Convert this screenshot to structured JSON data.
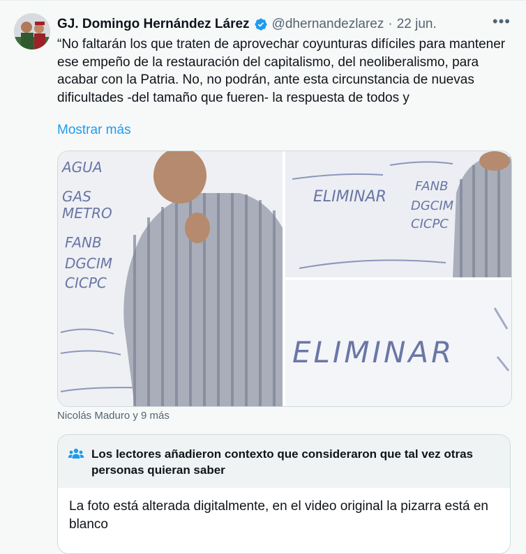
{
  "tweet": {
    "name": "GJ. Domingo Hernández Lárez",
    "handle": "@dhernandezlarez",
    "separator": "·",
    "date": "22 jun.",
    "more_label": "•••",
    "text": "“No faltarán los que traten de aprovechar coyunturas difíciles para mantener ese empeño de la restauración del capitalismo, del neoliberalismo, para acabar con la Patria. No, no podrán, ante esta circunstancia de nuevas dificultades -del tamaño que fueren- la respuesta de todos y",
    "show_more": "Mostrar más",
    "tagged": "Nicolás Maduro y 9 más"
  },
  "colors": {
    "accent": "#1d9bf0",
    "verified": "#1d9bf0",
    "muted": "#536471",
    "note_header_bg": "#eff3f4"
  },
  "media": {
    "photo1_words": [
      "AGUA",
      "GAS",
      "METRO",
      "FANB",
      "DGCIM",
      "CICPC"
    ],
    "photo2_words": [
      "ELIMINAR",
      "FANB",
      "DGCIM",
      "CICPC"
    ],
    "photo3_word": "ELIMINAR"
  },
  "community_note": {
    "icon": "people-icon",
    "title": "Los lectores añadieron contexto que consideraron que tal vez otras personas quieran saber",
    "body": "La foto está alterada digitalmente, en el video original la pizarra está en blanco"
  }
}
